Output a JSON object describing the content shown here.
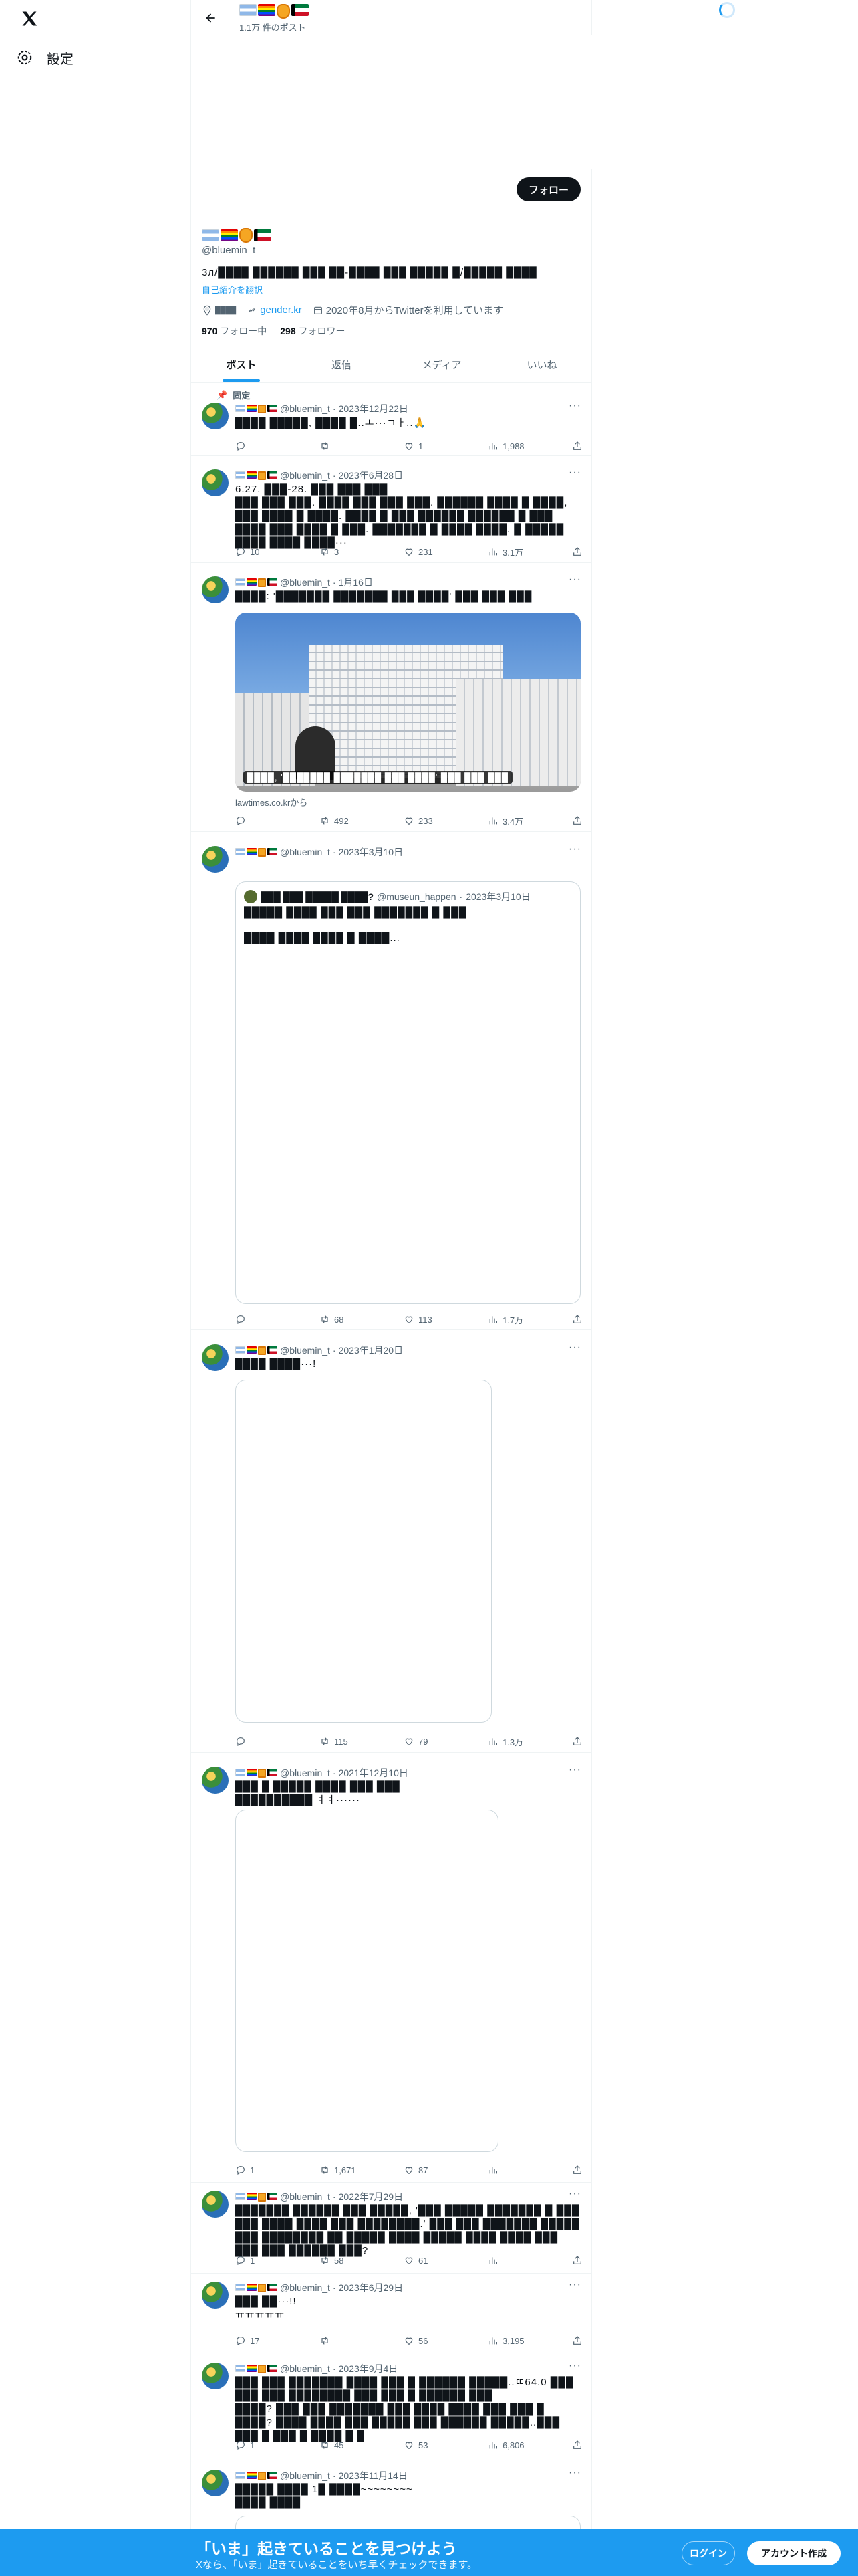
{
  "nav": {
    "settings_label": "設定"
  },
  "header": {
    "post_count": "1.1万 件のポスト"
  },
  "profile": {
    "follow_label": "フォロー",
    "handle": "@bluemin_t",
    "bio": "3л/████ ██████ ███ ██-████ ███ █████ █/█████ ████",
    "translate_label": "自己紹介を翻訳",
    "location": "████",
    "website": "gender.kr",
    "joined": "2020年8月からTwitterを利用しています",
    "following_count": "970",
    "following_label": "フォロー中",
    "followers_count": "298",
    "followers_label": "フォロワー"
  },
  "tabs": [
    "ポスト",
    "返信",
    "メディア",
    "いいね"
  ],
  "pinned_label": "固定",
  "tweets": [
    {
      "handle": "@bluemin_t",
      "date": "2023年12月22日",
      "text": "████ █████, ████ █..ㅗ···ㄱㅏ..🙏",
      "reply": "",
      "retweet": "",
      "like": "1",
      "views": "1,988"
    },
    {
      "handle": "@bluemin_t",
      "date": "2023年6月28日",
      "text": "6.27. ███-28. ███ ███ ███\n███ ███ ███. ████ ███ ███ ███. ██████ ████ █ ████, ███ ████ █ ████. ████ █ ███ ██████ ██████ █ ███ ████ ███ ████ █ ███. ███████ █ ████ ████. █ █████ ████ ████ ████···",
      "reply": "10",
      "retweet": "3",
      "like": "231",
      "views": "3.1万"
    },
    {
      "handle": "@bluemin_t",
      "date": "1月16日",
      "text": "████: '███████ ███████ ███ ████' ███ ███ ███",
      "media_caption": "████, '███████ ███████ ███ ████' ███ ███ ███",
      "source": "lawtimes.co.krから",
      "reply": "",
      "retweet": "492",
      "like": "233",
      "views": "3.4万"
    },
    {
      "handle": "@bluemin_t",
      "date": "2023年3月10日",
      "text": "",
      "quote": {
        "name": "███ ███ █████ ████?",
        "handle": "@museun_happen",
        "date": "2023年3月10日",
        "line1": "█████ ████ ███ ███ ███████ █ ███",
        "line2": "████ ████ ████ █ ████..."
      },
      "reply": "",
      "retweet": "68",
      "like": "113",
      "views": "1.7万"
    },
    {
      "handle": "@bluemin_t",
      "date": "2023年1月20日",
      "text": "████ ████···!",
      "reply": "",
      "retweet": "115",
      "like": "79",
      "views": "1.3万"
    },
    {
      "handle": "@bluemin_t",
      "date": "2021年12月10日",
      "text": "███ █ █████ ████ ███ ███\n██████████ ㅕㅕ······",
      "reply": "1",
      "retweet": "1,671",
      "like": "87",
      "views": ""
    },
    {
      "handle": "@bluemin_t",
      "date": "2022年7月29日",
      "text": "███████ ██████ ███ █████, '███ █████ ███████ █ ███ ███ ████ ████ ███ ████████.' ███ ███ ███████ █████ ███ ████████ ██ █████ ████ █████ ████ ████ ███ ███ ███ ██████ ███?",
      "reply": "1",
      "retweet": "58",
      "like": "61",
      "views": ""
    },
    {
      "handle": "@bluemin_t",
      "date": "2023年6月29日",
      "text": "███ ██···!!\nㅠㅠㅠㅠㅠ",
      "reply": "17",
      "retweet": "",
      "like": "56",
      "views": "3,195"
    },
    {
      "handle": "@bluemin_t",
      "date": "2023年9月4日",
      "text": "███ ███ ███████ ████ ███ █ ██████ █████..ㄸ64.0 ███ ███ ███ ████████ ███ ███ █ ██████ ███\n████? ███ ███ ███████ ███ ████ ████ ███ ███ █ ████? ████ ████ ███ █████ ███ ██████ █████..███ ███ █ ███ █ ████ █ █",
      "reply": "1",
      "retweet": "45",
      "like": "53",
      "views": "6,806"
    },
    {
      "handle": "@bluemin_t",
      "date": "2023年11月14日",
      "text": "█████ ████ 1█ ████~~~~~~~~\n████ ████",
      "reply": "",
      "retweet": "",
      "like": "",
      "views": ""
    }
  ],
  "bottom_bar": {
    "title": "「いま」起きていることを見つけよう",
    "subtitle": "Xなら、「いま」起きていることをいち早くチェックできます。",
    "login_label": "ログイン",
    "signup_label": "アカウント作成"
  }
}
